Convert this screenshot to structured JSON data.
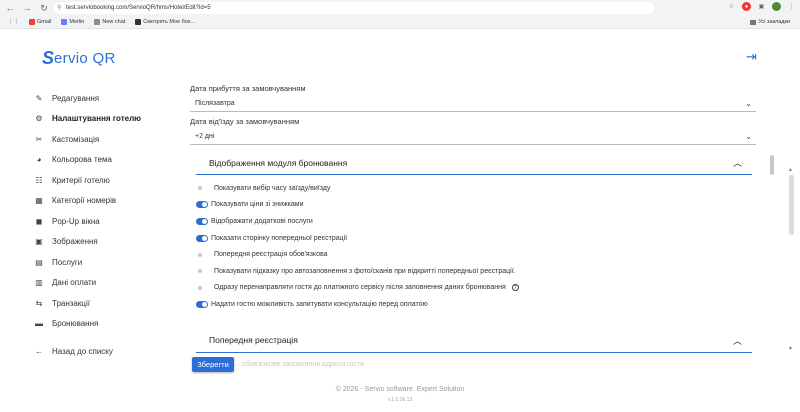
{
  "browser": {
    "url": "test.serviobooking.com/ServioQR/hms/Hotel/Edit?id=5",
    "bookmarks": [
      {
        "label": "Gmail",
        "color": "#ea4335"
      },
      {
        "label": "Merlin",
        "color": "#6b7cff"
      },
      {
        "label": "New chat",
        "color": "#8e8e8e"
      },
      {
        "label": "Смотреть  Мое бох...",
        "color": "#333333"
      }
    ],
    "bookmarks_right": "Усі закладки"
  },
  "logo": {
    "mark": "S",
    "text": "ervio QR"
  },
  "sidebar": {
    "items": [
      {
        "label": "Редагування",
        "icon": "pencil-icon",
        "glyph": "✎"
      },
      {
        "label": "Налаштування готелю",
        "icon": "gear-icon",
        "glyph": "⚙"
      },
      {
        "label": "Кастомізація",
        "icon": "wrench-icon",
        "glyph": "✂"
      },
      {
        "label": "Кольорова тема",
        "icon": "palette-icon",
        "glyph": "◕"
      },
      {
        "label": "Критерії готелю",
        "icon": "list-icon",
        "glyph": "☷"
      },
      {
        "label": "Категорії номерів",
        "icon": "tags-icon",
        "glyph": "▦"
      },
      {
        "label": "Pop-Up вікна",
        "icon": "comment-icon",
        "glyph": "◼"
      },
      {
        "label": "Зображення",
        "icon": "image-icon",
        "glyph": "▣"
      },
      {
        "label": "Послуги",
        "icon": "services-icon",
        "glyph": "▤"
      },
      {
        "label": "Дані оплати",
        "icon": "payment-icon",
        "glyph": "▥"
      },
      {
        "label": "Транзакції",
        "icon": "transactions-icon",
        "glyph": "⇆"
      },
      {
        "label": "Бронювання",
        "icon": "bed-icon",
        "glyph": "▬"
      }
    ],
    "back": {
      "label": "Назад до списку",
      "glyph": "←"
    }
  },
  "form": {
    "arrival": {
      "label": "Дата прибуття за замовчуванням",
      "value": "Післязавтра"
    },
    "departure": {
      "label": "Дата від'їзду за замовчуванням",
      "value": "+2 дні"
    }
  },
  "booking_module": {
    "title": "Відображення модуля бронювання",
    "options": [
      {
        "label": "Показувати вибір часу заїзду/виїзду",
        "on": false
      },
      {
        "label": "Показувати ціни зі знижками",
        "on": true
      },
      {
        "label": "Відображати додаткові послуги",
        "on": true
      },
      {
        "label": "Показати сторінку попередньої реєстрації",
        "on": true
      },
      {
        "label": "Попередня реєстрація обов'язкова",
        "on": false
      },
      {
        "label": "Показувати підказку про автозаповнення з фото/сканів при відкритті попередньої реєстрації.",
        "on": false
      },
      {
        "label": "Одразу перенаправляти гостя до платіжного сервісу після заповнення даних бронювання",
        "on": false,
        "help": "?"
      },
      {
        "label": "Надати гостю можливість запитувати консультацію перед оплатою",
        "on": true
      }
    ]
  },
  "prereg": {
    "title": "Попередня реєстрація",
    "faded": "...обов'язкове заповнення адреси гостя"
  },
  "save_label": "Зберегти",
  "footer": "© 2026 - Servio software. Expert Solution",
  "version": "v.1.5.36.13"
}
